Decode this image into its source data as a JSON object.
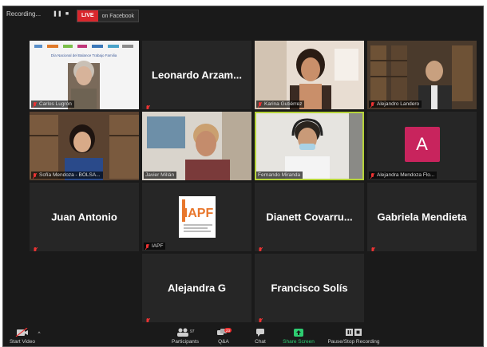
{
  "topbar": {
    "recording_label": "Recording...",
    "live_badge": "LIVE",
    "live_destination": "on Facebook"
  },
  "tiles": [
    {
      "name": "Carlos Lugrón",
      "kind": "video",
      "slide_title": "Día Nacional del Balance Trabajo Familia"
    },
    {
      "name": "Leonardo Arzam...",
      "kind": "name"
    },
    {
      "name": "Karina Gutiérrez",
      "kind": "video"
    },
    {
      "name": "Alejandro Landero",
      "kind": "video"
    },
    {
      "name": "Sofía Mendoza - BOLSA...",
      "kind": "video"
    },
    {
      "name": "Javier Millán",
      "kind": "video"
    },
    {
      "name": "Fernando Miranda",
      "kind": "video"
    },
    {
      "name": "Alejandra Mendoza Flo...",
      "kind": "avatar",
      "initial": "A"
    },
    {
      "name": "Juan Antonio",
      "kind": "name"
    },
    {
      "name": "IAPF",
      "kind": "logo",
      "logo_text": "IAPF"
    },
    {
      "name": "Dianett Covarru...",
      "kind": "name"
    },
    {
      "name": "Gabriela Mendieta",
      "kind": "name"
    },
    {
      "name": "Alejandra G",
      "kind": "name"
    },
    {
      "name": "Francisco Solís",
      "kind": "name"
    }
  ],
  "toolbar": {
    "start_video": "Start Video",
    "participants": "Participants",
    "participants_count": "97",
    "qa": "Q&A",
    "qa_badge": "23",
    "chat": "Chat",
    "share_screen": "Share Screen",
    "pause_stop_recording": "Pause/Stop Recording"
  },
  "colors": {
    "active_speaker": "#b6d33a",
    "live_red": "#d9262c",
    "avatar_pink": "#c8245d",
    "share_green": "#2ecc71"
  }
}
